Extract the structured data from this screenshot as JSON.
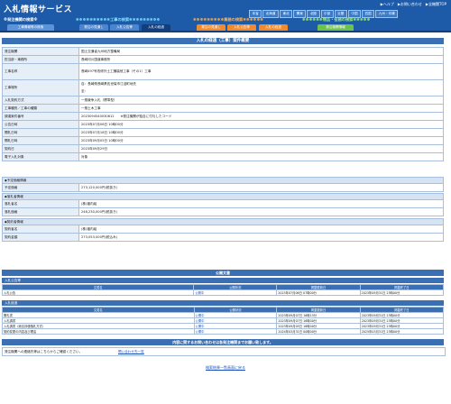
{
  "header": {
    "logo": "入札情報サービス",
    "toplinks": [
      "▶ヘルプ",
      "▶お問い合わせ",
      "▶全機関TOP"
    ],
    "regions": [
      "本省",
      "北海道",
      "東北",
      "関東",
      "北陸",
      "中部",
      "近畿",
      "中国",
      "四国",
      "九州・沖縄"
    ]
  },
  "groups": {
    "ordering": "※発注機関の検索※",
    "construction": "工事の検索",
    "services": "業務の検索",
    "goods": "物品・役務の検索",
    "other": "発注機関の検索"
  },
  "tabs": [
    "工事情報等の検索",
    "発注の見通し",
    "入札公告等",
    "入札の経過",
    "発注の見通し",
    "入札公告等",
    "入札の経過",
    "発注機関情報"
  ],
  "page_title": "入札の経過（工事）案件概要",
  "fields": [
    {
      "label": "発注機関",
      "value": "国土交通省九州地方整備局"
    },
    {
      "label": "担当部・事務所",
      "value": "長崎河川国道事務所"
    },
    {
      "label": "工事名称",
      "value": "長崎497号改修外土工舗装他工事（その1）工事"
    },
    {
      "label": "工事場所",
      "value": "自：長崎県長崎県佐世保市江迎町地先",
      "value2": "至："
    },
    {
      "label": "入札契約方式",
      "value": "一般競争入札（標準型）"
    },
    {
      "label": "工事種別／工事の種類",
      "value": "一般土木工事"
    },
    {
      "label": "調達案件番号",
      "value": "2023094540030612",
      "note": "※発注機関が独自に付与したコード"
    },
    {
      "label": "公告日時",
      "value": "2023年07月06日 10時00分"
    },
    {
      "label": "開札日時",
      "value": "2023年07月18日 10時00分"
    },
    {
      "label": "開札日時",
      "value": "2023年09月05日 10時00分"
    },
    {
      "label": "契約日",
      "value": "2023年09月29日"
    },
    {
      "label": "電子入札対象",
      "value": "対象"
    }
  ],
  "estimated_price_section": "◆予定価格情報",
  "estimated_price": {
    "label": "予定価格",
    "value": "273,120,000円(税抜き)"
  },
  "winner_section": "◆落札者情報",
  "winner": [
    {
      "label": "落札者名",
      "value": "(株)福内組"
    },
    {
      "label": "落札価格",
      "value": "248,230,000円(税抜き)"
    }
  ],
  "contract_section": "◆契約者情報",
  "contract": [
    {
      "label": "契約者名",
      "value": "(株)福内組"
    },
    {
      "label": "契約金額",
      "value": "273,053,000円(税込み)"
    }
  ],
  "public_docs_title": "公開文書",
  "notice_section": "入札公告等",
  "notice_headers": [
    "文書名",
    "公開状況",
    "掲載更新日",
    "掲載終了日"
  ],
  "notice_rows": [
    [
      "入札公告",
      "公開中",
      "2023年07月06日 07時00分",
      "2023年09月31日 23時00分"
    ]
  ],
  "process_section": "入札経過",
  "process_headers": [
    "文書名",
    "公開状況",
    "掲載更新日",
    "掲載終了日"
  ],
  "process_rows": [
    [
      "開札書",
      "公開中",
      "2023年09月07日 16時15分",
      "2023年09月31日 23時00分"
    ],
    [
      "入札調書",
      "公開中",
      "2023年09月07日 16時00分",
      "2023年09月31日 23時00分"
    ],
    [
      "入札調書（総合評価落札方式）",
      "公開中",
      "2023年09月05日 16時00分",
      "2023年09月31日 23時00分"
    ],
    [
      "契約変更の内容及び理由",
      "公開中",
      "2024年03月31日 00時00分",
      "2025年03月31日 23時00分"
    ]
  ],
  "contact_bar": "内容に関するお問い合わせは各発注機関までお願い致します。",
  "contact_label": "発注機関への連絡先等はこちらからご確認ください。",
  "contact_link": "問い合わせ先一覧",
  "back_link": "検索結果一覧画面に戻る"
}
